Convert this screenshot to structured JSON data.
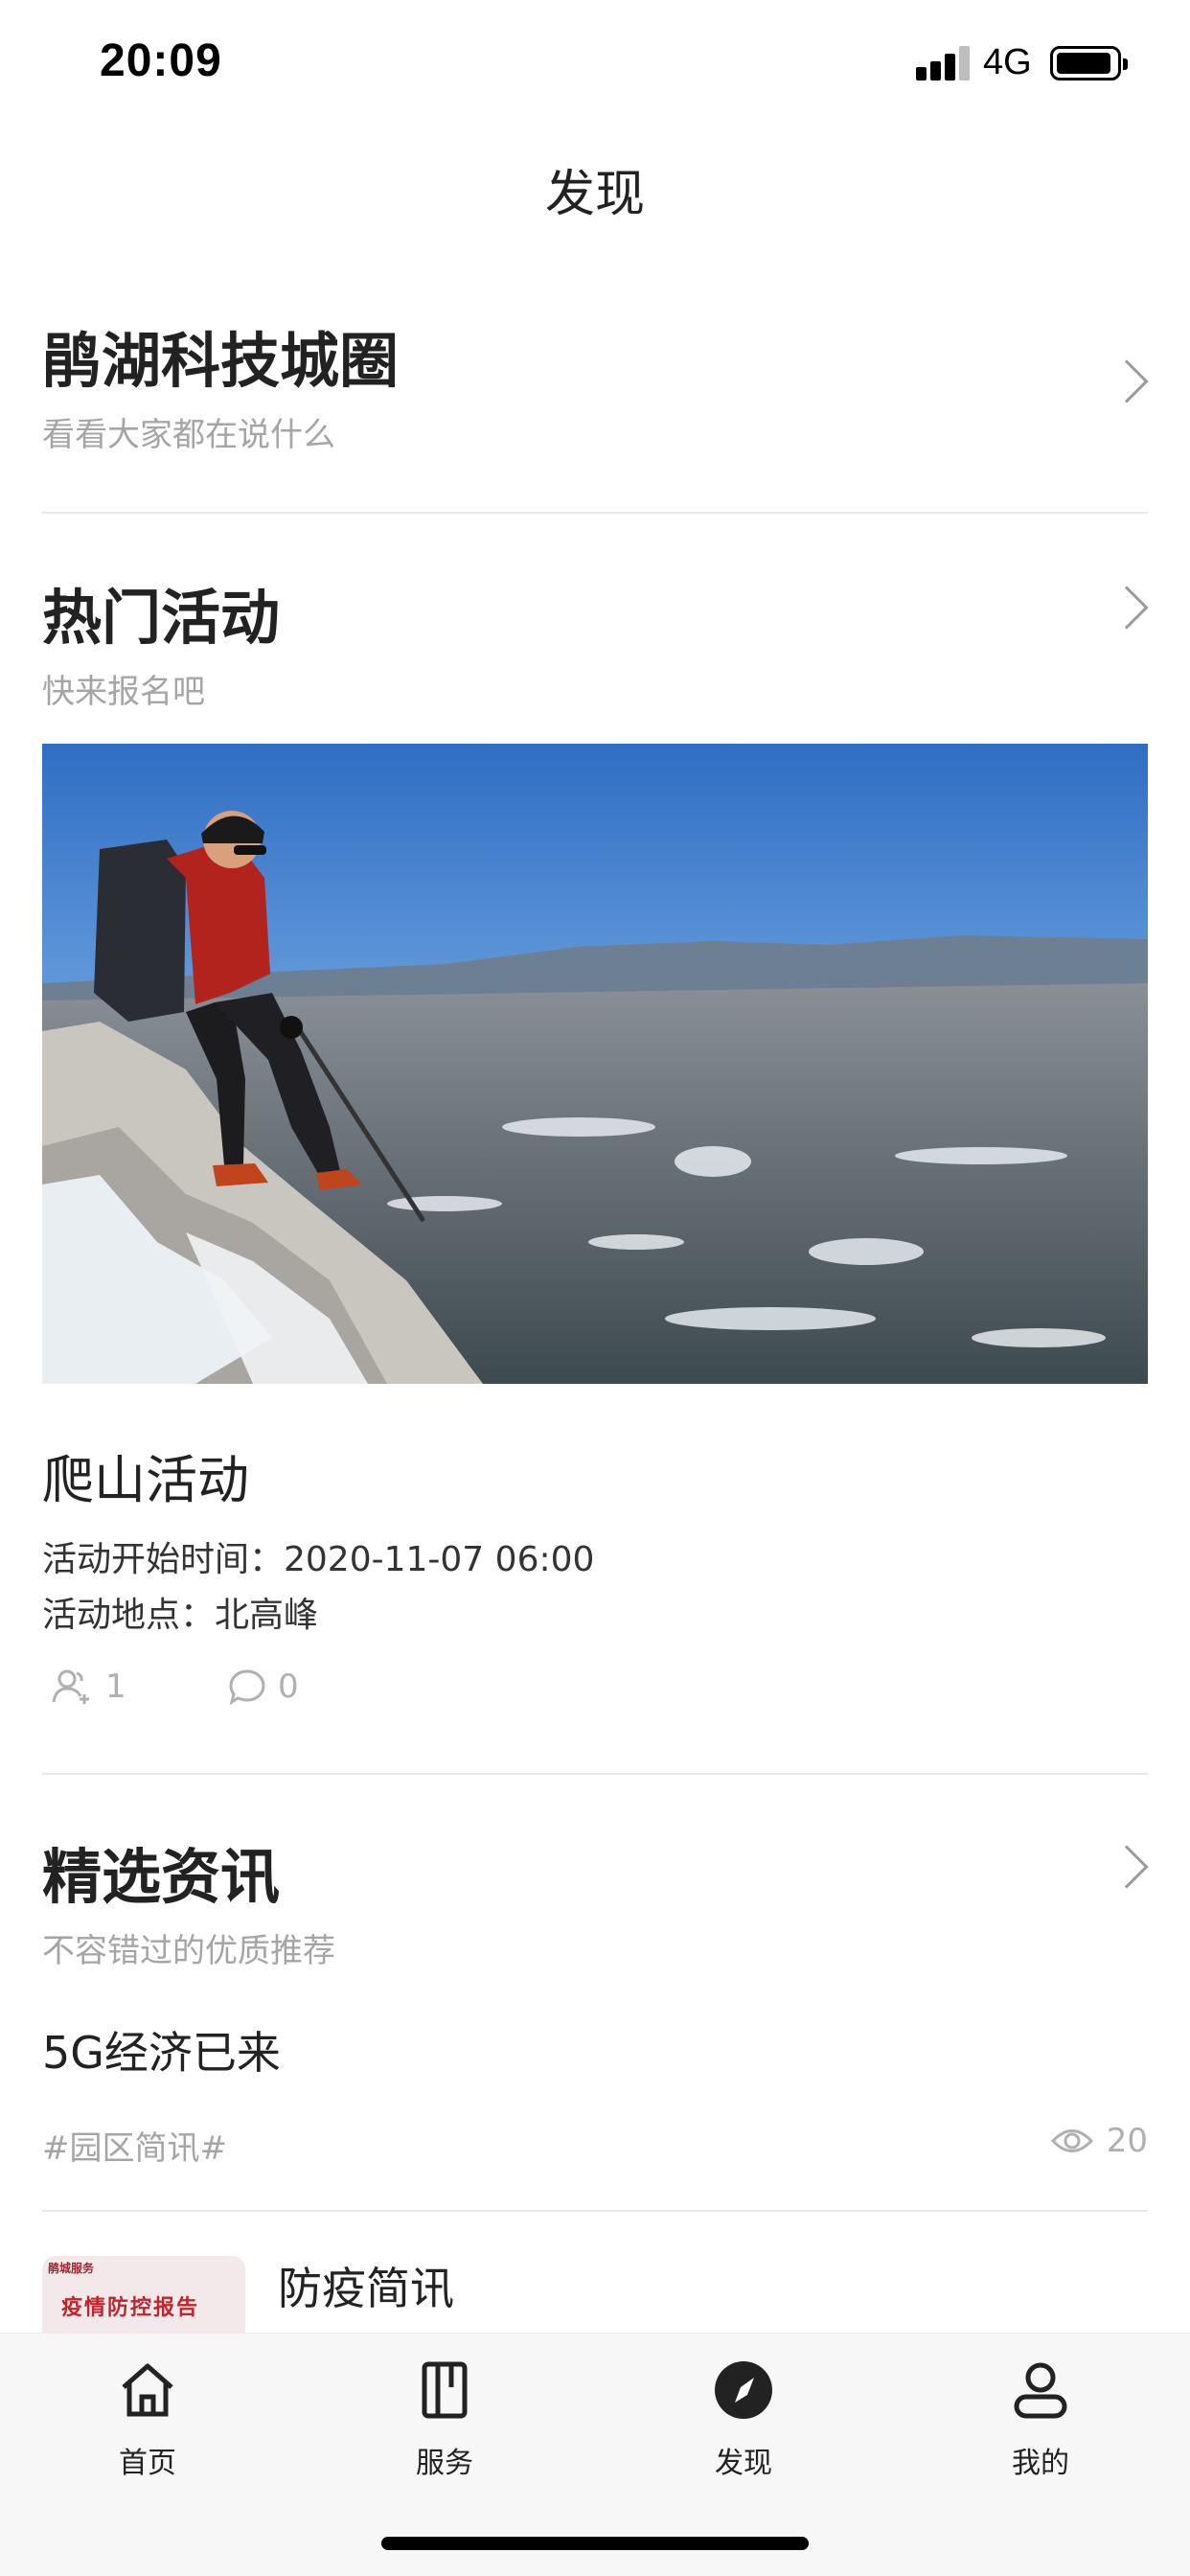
{
  "status_bar": {
    "time": "20:09",
    "network": "4G",
    "icons": [
      "signal-icon",
      "battery-icon"
    ]
  },
  "nav": {
    "title": "发现"
  },
  "circle": {
    "title": "鹃湖科技城圈",
    "subtitle": "看看大家都在说什么"
  },
  "activities": {
    "title": "热门活动",
    "subtitle": "快来报名吧",
    "event": {
      "title": "爬山活动",
      "start_time": "活动开始时间：2020-11-07 06:00",
      "location": "活动地点：北高峰",
      "participants": "1",
      "comments": "0"
    }
  },
  "news": {
    "title": "精选资讯",
    "subtitle": "不容错过的优质推荐",
    "items": [
      {
        "title": "5G经济已来",
        "tag": "#园区简讯#",
        "views": "20"
      },
      {
        "title": "防疫简讯",
        "thumb_text": "疫情防控报告",
        "thumb_small": "鹃城服务"
      }
    ]
  },
  "tab_bar": {
    "tabs": [
      {
        "label": "首页",
        "icon": "home-icon"
      },
      {
        "label": "服务",
        "icon": "book-icon"
      },
      {
        "label": "发现",
        "icon": "compass-icon",
        "active": true
      },
      {
        "label": "我的",
        "icon": "user-icon"
      }
    ]
  },
  "colors": {
    "text_primary": "#222222",
    "text_secondary": "#a5a5a5",
    "divider": "#e8e8e8",
    "tab_bar_bg": "#f7f7f7"
  }
}
